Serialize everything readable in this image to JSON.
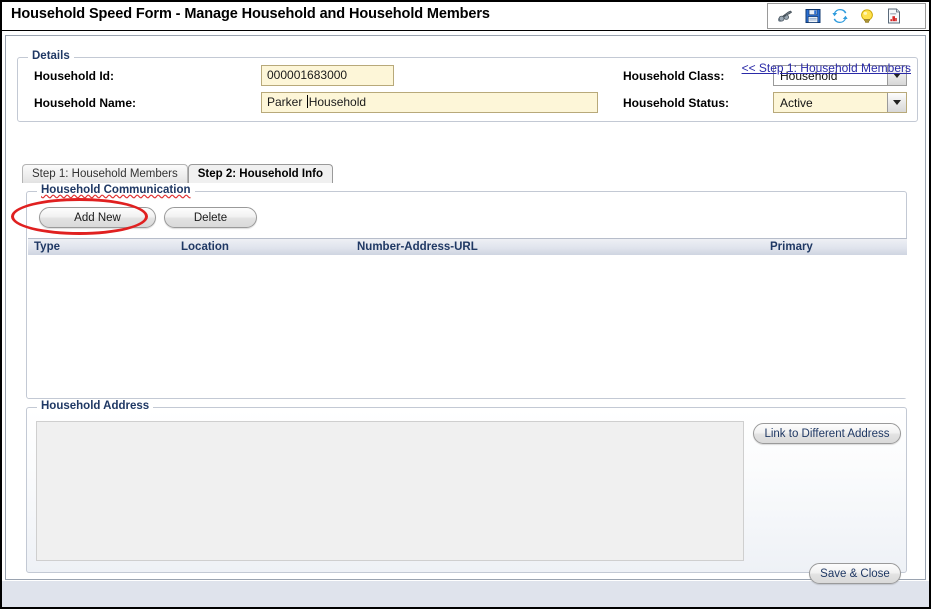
{
  "window": {
    "title": "Household Speed Form - Manage Household and Household Members"
  },
  "toolbar": {
    "icons": [
      {
        "name": "binoculars-icon",
        "label": "Find"
      },
      {
        "name": "save-icon",
        "label": "Save"
      },
      {
        "name": "refresh-icon",
        "label": "Refresh"
      },
      {
        "name": "lightbulb-icon",
        "label": "Hint"
      },
      {
        "name": "report-icon",
        "label": "Report"
      }
    ]
  },
  "details": {
    "legend": "Details",
    "household_id_label": "Household Id:",
    "household_id_value": "000001683000",
    "household_name_label": "Household Name:",
    "household_name_value_before_caret": "Parker ",
    "household_name_value_after_caret": "Household",
    "household_class_label": "Household Class:",
    "household_class_value": "Household",
    "household_status_label": "Household Status:",
    "household_status_value": "Active"
  },
  "tabs": [
    {
      "label": "Step 1: Household Members",
      "active": false
    },
    {
      "label": "Step 2: Household Info",
      "active": true
    }
  ],
  "communication": {
    "legend": "Household Communication",
    "add_new_label": "Add New",
    "delete_label": "Delete",
    "columns": [
      "Type",
      "Location",
      "Number-Address-URL",
      "Primary"
    ],
    "rows": []
  },
  "address": {
    "legend": "Household Address",
    "panel_text": "",
    "link_button_label": "Link to Different Address",
    "save_close_label": "Save & Close"
  },
  "footer": {
    "step1_link": "<< Step 1: Household Members"
  },
  "colors": {
    "accent_blue": "#1f3864",
    "link_blue": "#2a2aa8",
    "field_yellow": "#fdf6d8",
    "annotation_red": "#e02020",
    "header_grad_top": "#eef0f5",
    "header_grad_bottom": "#ccd2df"
  }
}
